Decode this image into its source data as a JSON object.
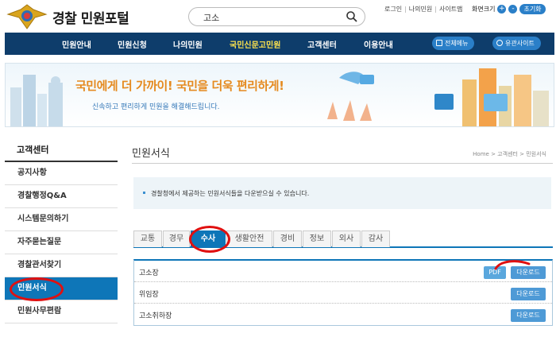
{
  "header": {
    "site_name": "경찰 민원포털",
    "search": {
      "value": "고소"
    },
    "util_links": [
      "로그인",
      "나의민원",
      "사이트맵"
    ],
    "font_size_label": "화면크기",
    "font_plus": "+",
    "font_minus": "-",
    "font_reset": "초기화"
  },
  "nav": {
    "items": [
      "민원안내",
      "민원신청",
      "나의민원",
      "국민신문고민원",
      "고객센터",
      "이용안내"
    ],
    "active_index": 3,
    "all_menu": "전체메뉴",
    "related_sites": "유관사이트"
  },
  "banner": {
    "headline_part1": "국민에게 더 가까이!",
    "headline_part2": "국민을 더욱 편리하게!",
    "subtitle": "신속하고 편리하게 민원을 해결해드립니다."
  },
  "sidebar": {
    "title": "고객센터",
    "items": [
      "공지사항",
      "경찰행정Q&A",
      "시스템문의하기",
      "자주묻는질문",
      "경찰관서찾기",
      "민원서식",
      "민원사무편람"
    ],
    "active_index": 5
  },
  "main": {
    "title": "민원서식",
    "breadcrumb": "Home > 고객센터 > 민원서식",
    "info": "경찰청에서 제공하는 민원서식들을 다운받으실 수 있습니다.",
    "tabs": [
      "교통",
      "경무",
      "수사",
      "생활안전",
      "경비",
      "정보",
      "외사",
      "감사"
    ],
    "active_tab": 2,
    "rows": [
      {
        "name": "고소장",
        "pdf": "PDF",
        "download": "다운로드"
      },
      {
        "name": "위임장",
        "download": "다운로드"
      },
      {
        "name": "고소취하장",
        "download": "다운로드"
      }
    ]
  },
  "colors": {
    "nav_bg": "#0e3d6b",
    "accent": "#0e76b8",
    "highlight_marker": "#e01010"
  }
}
